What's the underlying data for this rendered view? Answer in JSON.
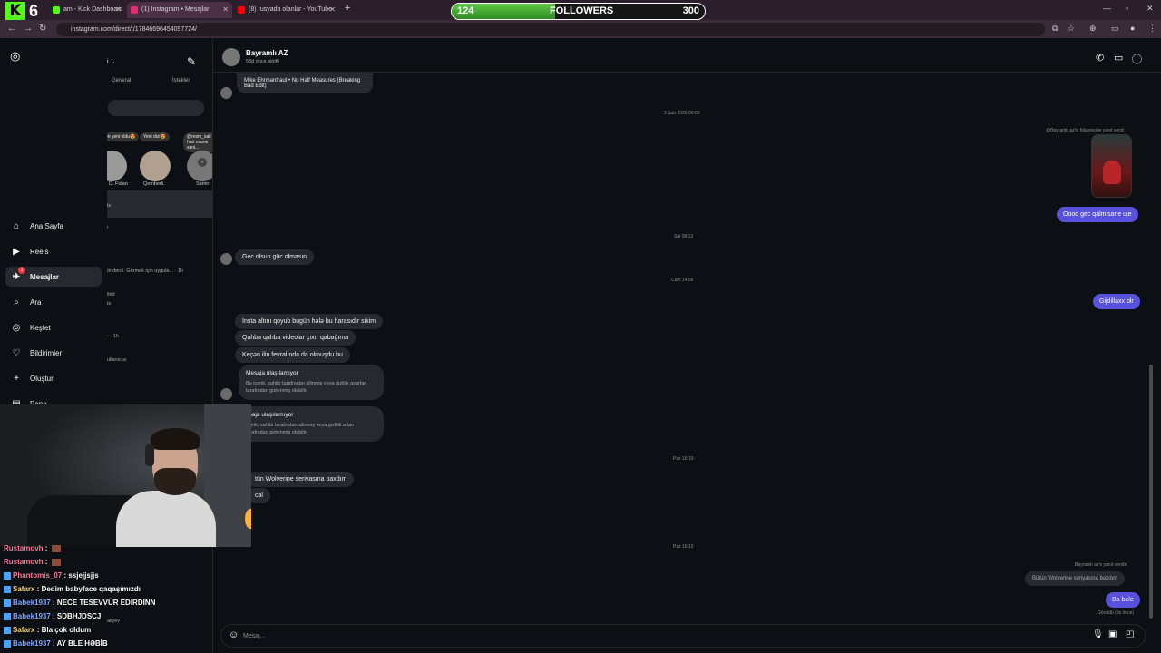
{
  "overlay": {
    "kick_number": "6",
    "followers": {
      "label": "FOLLOWERS",
      "current": "124",
      "goal": "300",
      "progress": 0.41
    }
  },
  "browser": {
    "tabs": [
      {
        "title": "am - Kick Dashboard",
        "active": false,
        "icon_color": "#53fc18"
      },
      {
        "title": "(1) Instagram • Mesajlar",
        "active": true,
        "icon_color": "#e1306c"
      },
      {
        "title": "(8) rusyada olanlar - YouTube",
        "active": false,
        "icon_color": "#ff0000"
      }
    ],
    "url": "instagram.com/direct/t/17846696454097724/"
  },
  "sidebar": {
    "items": [
      {
        "label": "Ana Sayfa",
        "icon": "home-icon",
        "glyph": "⌂"
      },
      {
        "label": "Reels",
        "icon": "reels-icon",
        "glyph": "▶"
      },
      {
        "label": "Mesajlar",
        "icon": "messenger-icon",
        "glyph": "✈",
        "badge": "1"
      },
      {
        "label": "Ara",
        "icon": "search-icon",
        "glyph": "⌕"
      },
      {
        "label": "Keşfet",
        "icon": "explore-icon",
        "glyph": "◎"
      },
      {
        "label": "Bildirimler",
        "icon": "heart-icon",
        "glyph": "♡"
      },
      {
        "label": "Oluştur",
        "icon": "plus-icon",
        "glyph": "+"
      },
      {
        "label": "Pano",
        "icon": "dashboard-icon",
        "glyph": "▤"
      }
    ]
  },
  "inbox": {
    "header_fragment": "i ⌄",
    "tab_general": "General",
    "tab_requests": "İstekler",
    "notes": [
      {
        "bubble": "en yeni oldu😍",
        "name": "D. Fidan"
      },
      {
        "bubble": "Yeni dizi😍",
        "name": "Qemberli."
      },
      {
        "bubble": "@resm_sali hari manie sani...",
        "name": "Samir"
      }
    ],
    "snippets": [
      "ts",
      "ı",
      "önderdi. Görmek için uygula... · 1h",
      "ihid",
      "ts",
      "- · 1h",
      "ullanıcısı",
      "aliyev"
    ]
  },
  "chat": {
    "name": "Bayramlı AZ",
    "status": "58d önce aktifti",
    "shared_reel": "Mike Ehrmantraut • No Half Measures (Breaking Bad Edit)",
    "ts1": "3 Şub 2026 00:03",
    "story_reply_note": "@Bayramlı az'in hikayesine yanıt verdi",
    "out1": "Oooo gec qalmisane uje",
    "ts2": "Sal 08:13",
    "in1": "Gec olsun güc olmasın",
    "ts3": "Cum 14:56",
    "out2": "Gijdillaxx blr",
    "in2": "İnsta altını qoyub bugün hələ bu harasıdır sikim",
    "in3": "Qahba qahba videolar çıxır qabağıma",
    "in4": "Keçən ilin fevralında da olmuşdu bu",
    "unavail_title": "Mesaja ulaşılamıyor",
    "unavail_desc": "Bu içerik, sahibi tarafından silinmiş veya gizlilik ayarları tarafından gizlenmiş olabilir.",
    "unavail_title2": "esaja ulaşılamıyor",
    "unavail_desc2": "içerik, sahibi tarafından silinmiş veya gizlilik arları tarafından gizlenmiş olabilir.",
    "ts4": "Paz 16:19",
    "in5": "tün Wolverine seriyasına baxdım",
    "in6": "cal",
    "ts5": "Paz 16:10",
    "reply_note": "Bayramlı az'e yanıt verdin",
    "quoted": "Bütün Wolverine seriyasına baxdım",
    "out3": "Ba bele",
    "seen": "Görüldü (9s önce)",
    "composer_placeholder": "Mesaj..."
  },
  "stream_chat": [
    {
      "user": "Rustamovh",
      "sep": " : ",
      "msg": "",
      "emote": true,
      "color": "pink"
    },
    {
      "user": "Rustamovh",
      "sep": " : ",
      "msg": "",
      "emote": true,
      "color": "pink"
    },
    {
      "user": "Phantomis_07",
      "sep": " : ",
      "msg": "ssjejjsjjs",
      "emote": false,
      "color": "pink"
    },
    {
      "user": "Safarx",
      "sep": " : ",
      "msg": "Dedim babyface qaqaşımızdı",
      "emote": false,
      "color": "gold"
    },
    {
      "user": "Babek1937",
      "sep": " : ",
      "msg": "NECE TESEVVÜR EDİRDİNN",
      "emote": false,
      "color": "blue"
    },
    {
      "user": "Babek1937",
      "sep": " : ",
      "msg": "SDBHJDSCJ",
      "emote": false,
      "color": "blue"
    },
    {
      "user": "Safarx",
      "sep": " : ",
      "msg": "Bla çok oldum",
      "emote": false,
      "color": "gold"
    },
    {
      "user": "Babek1937",
      "sep": " : ",
      "msg": "AY BLE HƏBİB",
      "emote": false,
      "color": "blue"
    }
  ]
}
